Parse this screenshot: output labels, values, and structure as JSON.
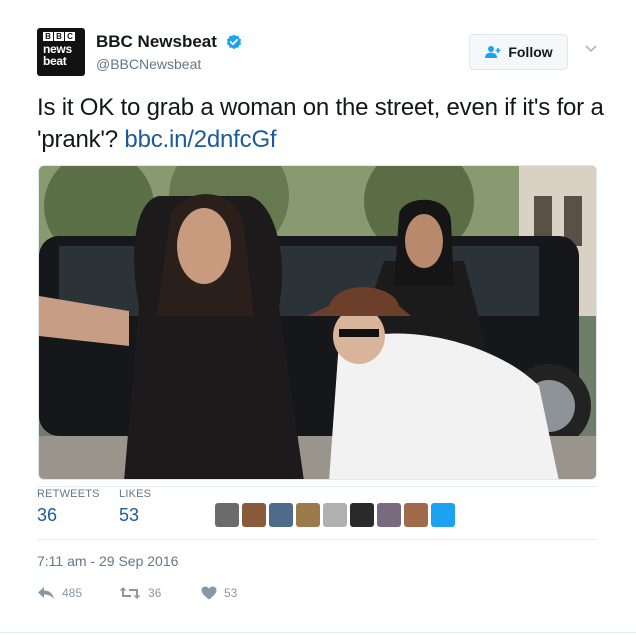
{
  "account": {
    "display_name": "BBC Newsbeat",
    "handle": "@BBCNewsbeat",
    "avatar_letters": [
      "B",
      "B",
      "C"
    ],
    "avatar_word_1": "news",
    "avatar_word_2": "beat"
  },
  "follow_button": {
    "label": "Follow"
  },
  "tweet": {
    "text": "Is it OK to grab a woman on the street, even if it's for a 'prank'? ",
    "link": "bbc.in/2dnfcGf",
    "timestamp": "7:11 am - 29 Sep 2016"
  },
  "stats": {
    "retweets_label": "RETWEETS",
    "retweets_count": "36",
    "likes_label": "LIKES",
    "likes_count": "53"
  },
  "likers": [
    {
      "color": "#6b6b6b"
    },
    {
      "color": "#8a5a3c"
    },
    {
      "color": "#4f6a8a"
    },
    {
      "color": "#9c7a4a"
    },
    {
      "color": "#b0b0b0"
    },
    {
      "color": "#2a2a2a"
    },
    {
      "color": "#7a6a80"
    },
    {
      "color": "#a06b4b"
    },
    {
      "color": "#1da1f2"
    }
  ],
  "actions": {
    "reply_count": "485",
    "retweet_count": "36",
    "like_count": "53"
  },
  "colors": {
    "link": "#1b5b9c",
    "muted": "#657786",
    "verified": "#1da1f2"
  }
}
